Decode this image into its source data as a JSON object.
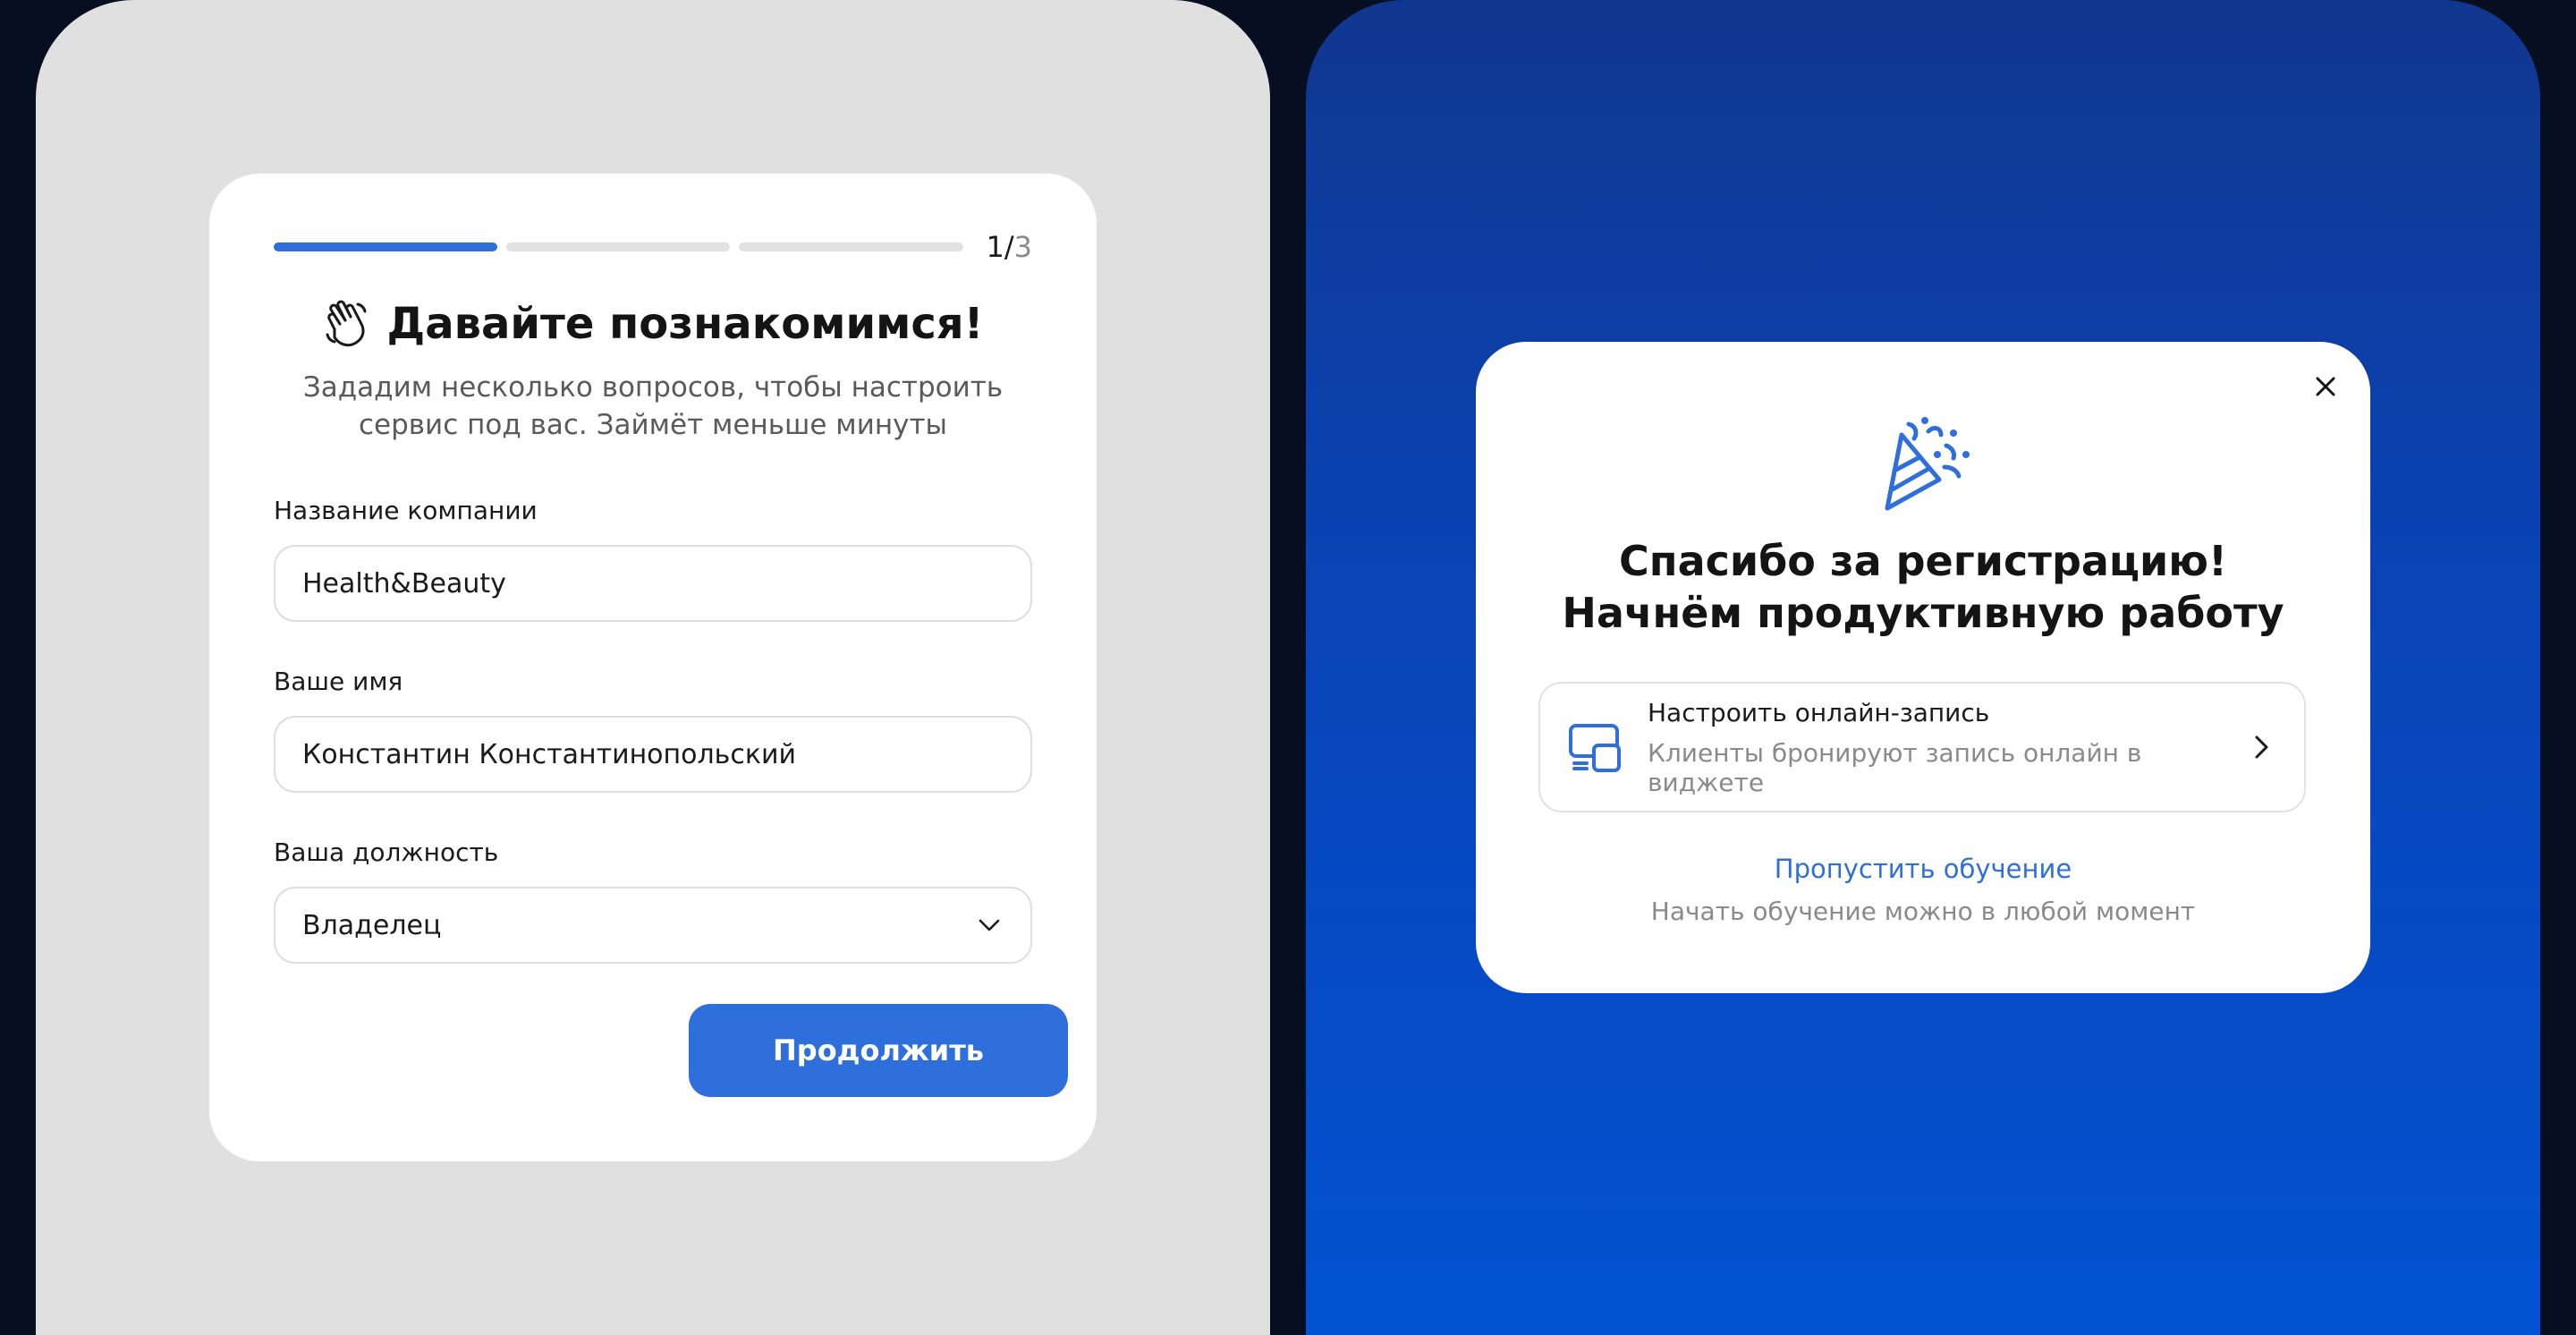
{
  "onboarding": {
    "progress": {
      "current": 1,
      "total": 3,
      "current_label": "1/",
      "total_label": "3"
    },
    "title": "Давайте познакомимся!",
    "subtitle_line1": "Зададим несколько вопросов, чтобы настроить",
    "subtitle_line2": "сервис под вас. Займёт меньше минуты",
    "fields": {
      "company": {
        "label": "Название компании",
        "value": "Health&Beauty"
      },
      "name": {
        "label": "Ваше имя",
        "value": "Константин Константинопольский"
      },
      "position": {
        "label": "Ваша должность",
        "value": "Владелец"
      }
    },
    "continue_label": "Продолжить"
  },
  "modal": {
    "title_line1": "Спасибо за регистрацию!",
    "title_line2": "Начнём продуктивную работу",
    "option": {
      "title": "Настроить онлайн-запись",
      "description": "Клиенты бронируют запись онлайн в виджете"
    },
    "skip_label": "Пропустить обучение",
    "skip_note": "Начать обучение можно в любой момент"
  },
  "icons": [
    "waving-hand-icon",
    "chevron-down-icon",
    "close-icon",
    "party-popper-icon",
    "widget-devices-icon",
    "chevron-right-icon"
  ],
  "colors": {
    "accent": "#2f6fdc",
    "left_bg": "#e0e0e0",
    "right_bg": "#0a44b8",
    "page_bg": "#060f1f"
  }
}
